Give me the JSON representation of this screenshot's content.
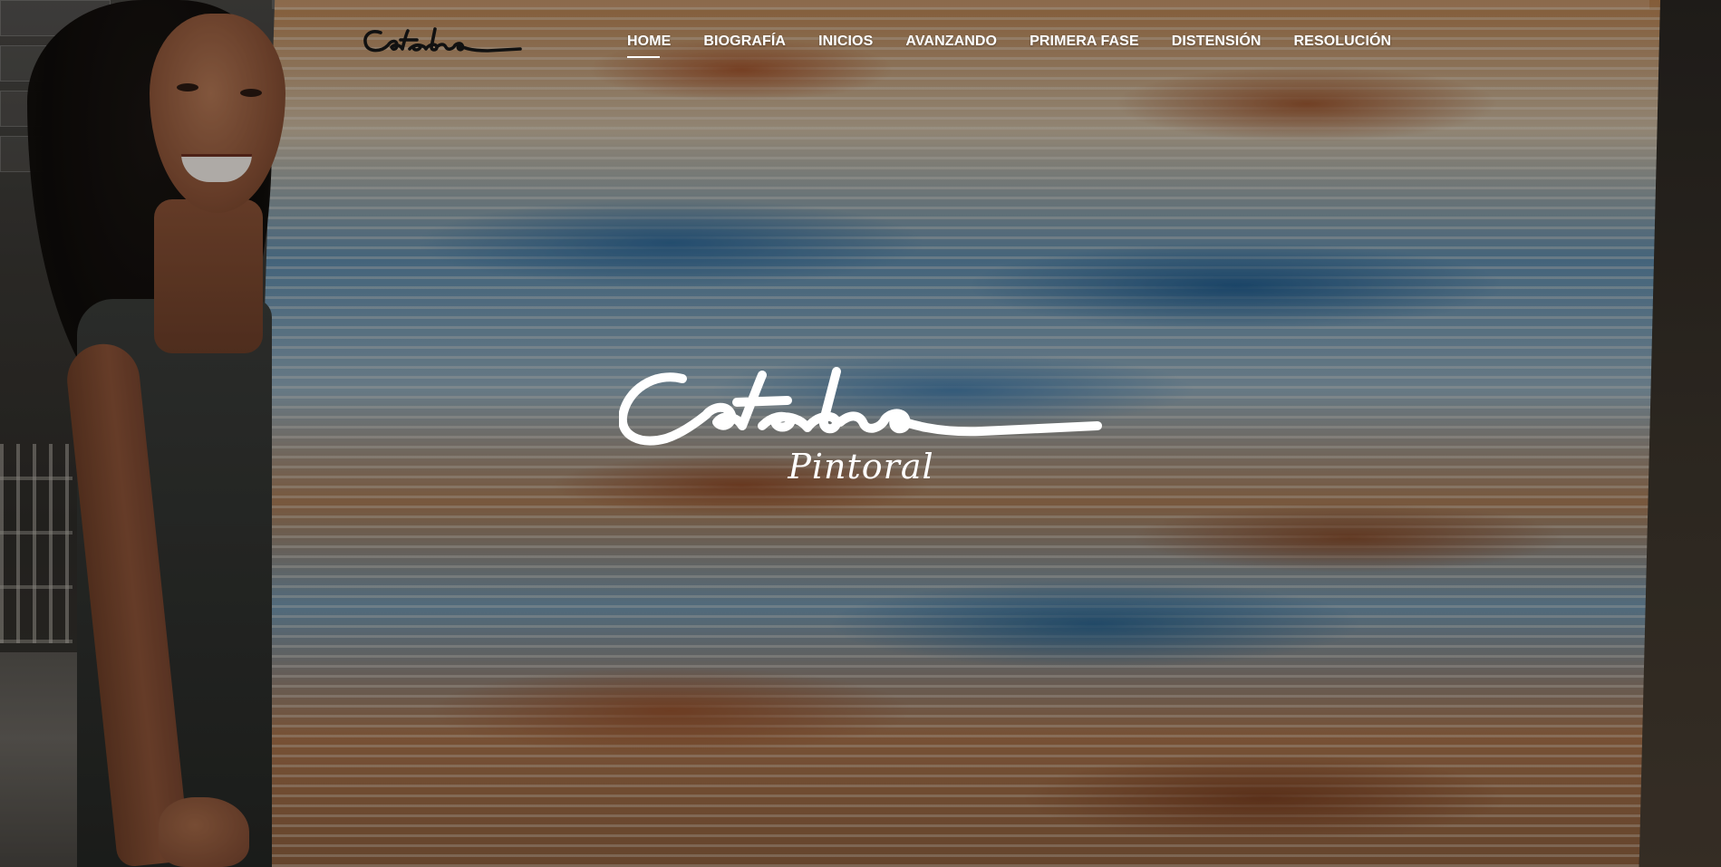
{
  "brand": {
    "name": "Catedra",
    "tagline": "Pintoral"
  },
  "nav": {
    "items": [
      {
        "label": "HOME",
        "active": true
      },
      {
        "label": "BIOGRAFÍA",
        "active": false
      },
      {
        "label": "INICIOS",
        "active": false
      },
      {
        "label": "AVANZANDO",
        "active": false
      },
      {
        "label": "PRIMERA FASE",
        "active": false
      },
      {
        "label": "DISTENSIÓN",
        "active": false
      },
      {
        "label": "RESOLUCIÓN",
        "active": false
      }
    ]
  },
  "colors": {
    "nav_text": "#ffffff",
    "header_logo": "#111111",
    "hero_logo": "#ffffff"
  }
}
